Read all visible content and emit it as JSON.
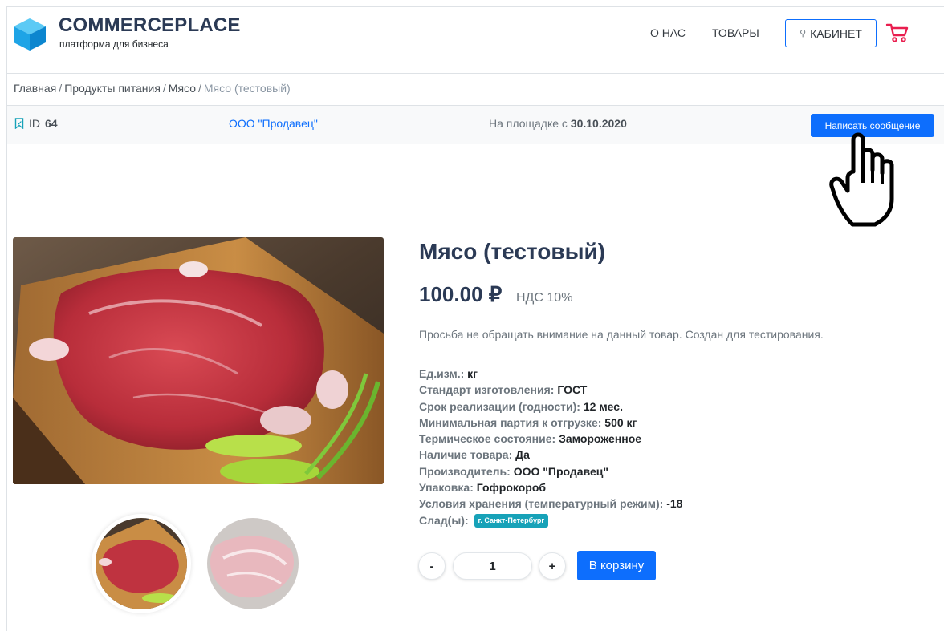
{
  "header": {
    "brand": "COMMERCEPLACE",
    "tagline": "платформа для бизнеса",
    "nav": {
      "about": "О НАС",
      "products": "ТОВАРЫ"
    },
    "cabinet_label": "КАБИНЕТ",
    "icons": {
      "logo": "blue-cube-logo-icon",
      "user": "user-icon",
      "cart": "cart-icon"
    },
    "colors": {
      "brand_text": "#2b3a55",
      "accent": "#0d6efd",
      "cart": "#e91e4f"
    }
  },
  "breadcrumb": {
    "items": [
      "Главная",
      "Продукты питания",
      "Мясо"
    ],
    "separator": "/",
    "current": "Мясо (тестовый)"
  },
  "seller_bar": {
    "id_label": "ID",
    "id_value": "64",
    "seller_name": "ООО \"Продавец\"",
    "since_label": "На площадке с",
    "since_date": "30.10.2020",
    "message_button": "Написать сообщение"
  },
  "product": {
    "title": "Мясо (тестовый)",
    "price": "100.00 ₽",
    "vat": "НДС 10%",
    "description": "Просьба не обращать внимание на данный товар. Создан для тестирования.",
    "specs": [
      {
        "key": "Ед.изм.:",
        "value": "кг"
      },
      {
        "key": "Стандарт изготовления:",
        "value": "ГОСТ"
      },
      {
        "key": "Срок реализации (годности):",
        "value": "12 мес."
      },
      {
        "key": "Минимальная партия к отгрузке:",
        "value": "500 кг"
      },
      {
        "key": "Термическое состояние:",
        "value": "Замороженное"
      },
      {
        "key": "Наличие товара:",
        "value": "Да"
      },
      {
        "key": "Производитель:",
        "value": "ООО \"Продавец\""
      },
      {
        "key": "Упаковка:",
        "value": "Гофрокороб"
      },
      {
        "key": "Условия хранения (температурный режим):",
        "value": "-18"
      }
    ],
    "warehouse_label": "Слад(ы):",
    "warehouse_badge": "г. Санкт-Петербург",
    "quantity": {
      "minus": "-",
      "value": "1",
      "plus": "+"
    },
    "add_to_cart": "В корзину"
  }
}
